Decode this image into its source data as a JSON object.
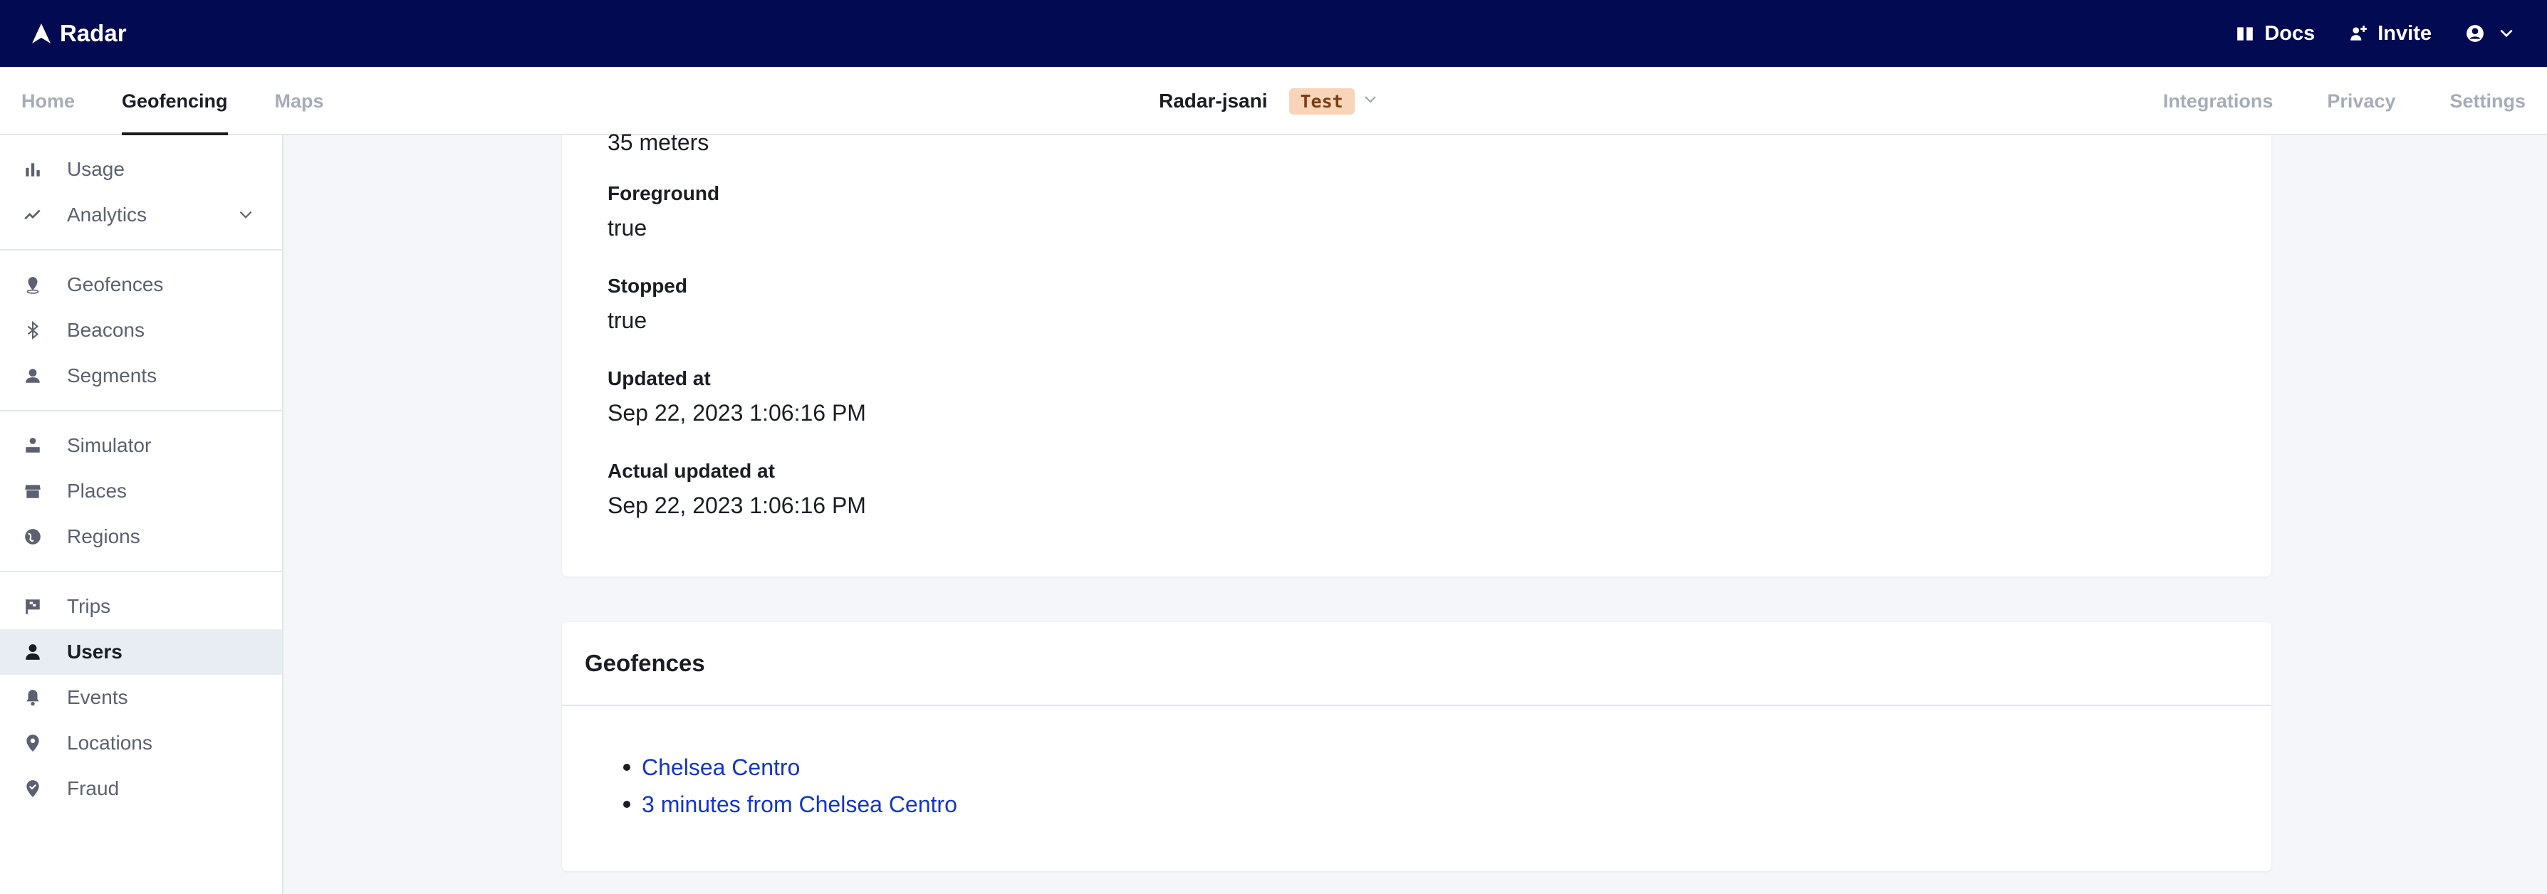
{
  "app": {
    "brand": "Radar",
    "actions": {
      "docs": "Docs",
      "invite": "Invite"
    }
  },
  "nav": {
    "tabs_left": [
      "Home",
      "Geofencing",
      "Maps"
    ],
    "active_tab": "Geofencing",
    "project": "Radar-jsani",
    "environment": "Test",
    "tabs_right": [
      "Integrations",
      "Privacy",
      "Settings"
    ]
  },
  "sidebar": {
    "groups": [
      [
        {
          "label": "Usage",
          "icon": "bar-chart-icon"
        },
        {
          "label": "Analytics",
          "icon": "trend-icon"
        }
      ],
      [
        {
          "label": "Geofences",
          "icon": "geofence-pin-icon"
        },
        {
          "label": "Beacons",
          "icon": "bluetooth-icon"
        },
        {
          "label": "Segments",
          "icon": "segment-icon"
        }
      ],
      [
        {
          "label": "Simulator",
          "icon": "simulator-icon"
        },
        {
          "label": "Places",
          "icon": "store-icon"
        },
        {
          "label": "Regions",
          "icon": "globe-icon"
        }
      ],
      [
        {
          "label": "Trips",
          "icon": "flag-icon"
        },
        {
          "label": "Users",
          "icon": "user-icon"
        },
        {
          "label": "Events",
          "icon": "bell-icon"
        },
        {
          "label": "Locations",
          "icon": "pin-icon"
        },
        {
          "label": "Fraud",
          "icon": "shield-pin-icon"
        }
      ]
    ],
    "active": "Users"
  },
  "details": {
    "accuracy_value": "35 meters",
    "foreground_label": "Foreground",
    "foreground_value": "true",
    "stopped_label": "Stopped",
    "stopped_value": "true",
    "updated_label": "Updated at",
    "updated_value": "Sep 22, 2023 1:06:16 PM",
    "actual_updated_label": "Actual updated at",
    "actual_updated_value": "Sep 22, 2023 1:06:16 PM"
  },
  "geofences": {
    "title": "Geofences",
    "items": [
      "Chelsea Centro",
      "3 minutes from Chelsea Centro"
    ]
  },
  "colors": {
    "topbar": "#020b52",
    "link": "#1434cb",
    "badge_bg": "#f8d4b8"
  }
}
